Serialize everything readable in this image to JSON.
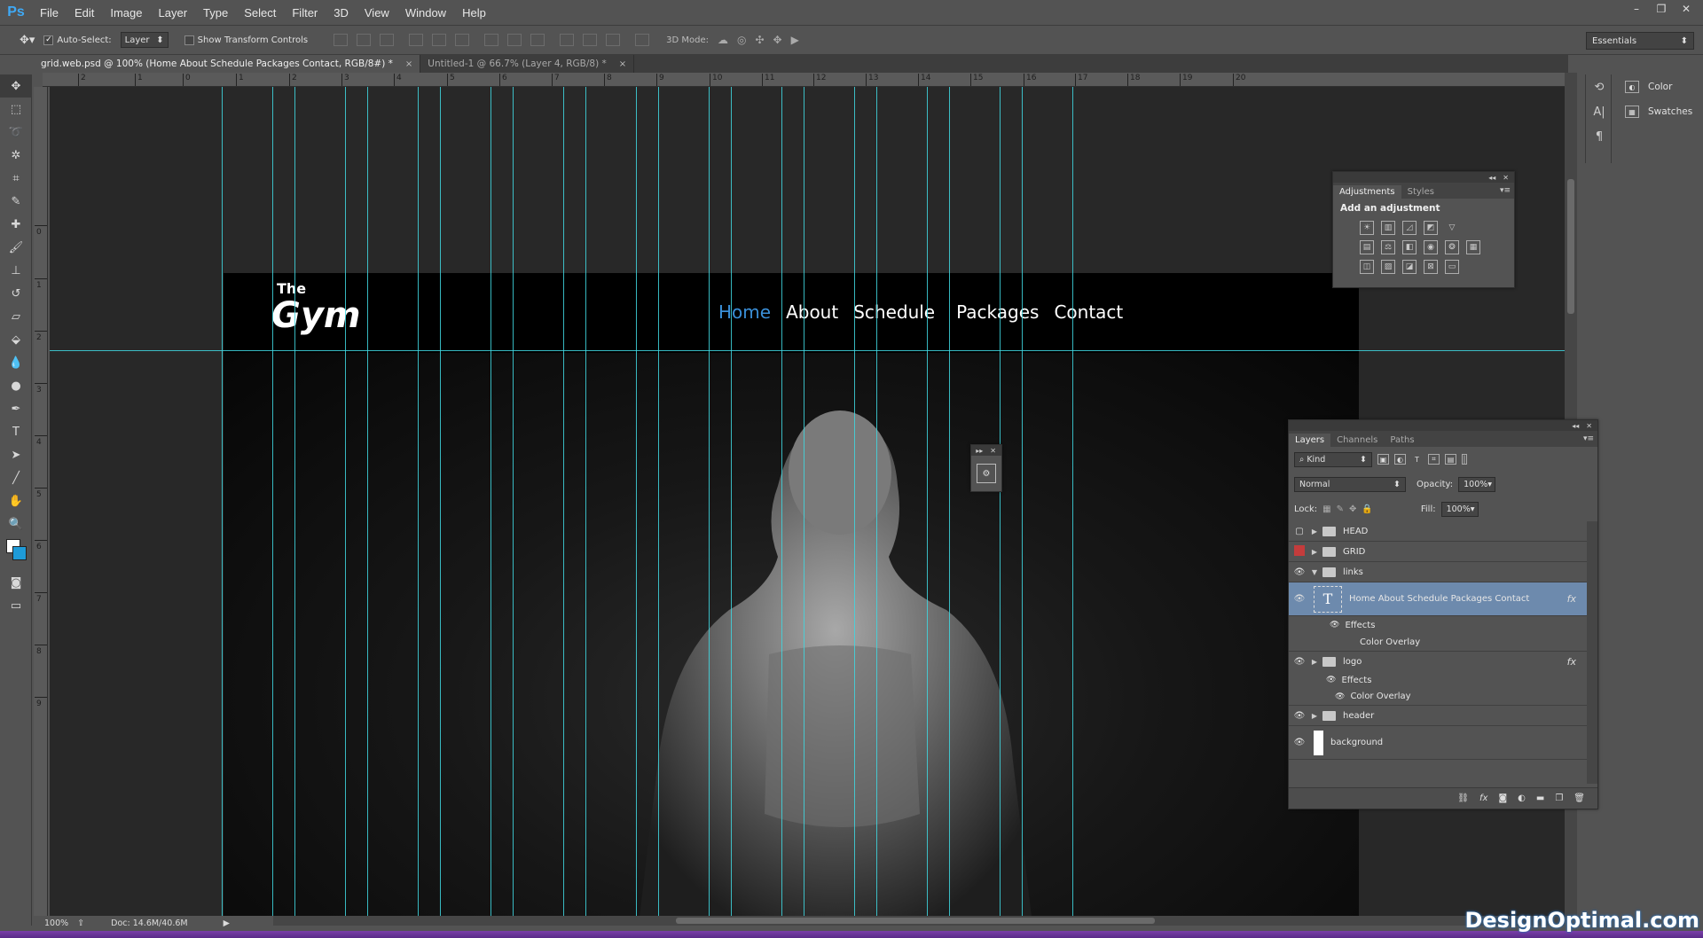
{
  "app": {
    "logo": "Ps"
  },
  "menu": [
    "File",
    "Edit",
    "Image",
    "Layer",
    "Type",
    "Select",
    "Filter",
    "3D",
    "View",
    "Window",
    "Help"
  ],
  "window_controls": [
    "–",
    "❐",
    "✕"
  ],
  "options": {
    "auto_select_label": "Auto-Select:",
    "auto_select_value": "Layer",
    "show_transform_label": "Show Transform Controls",
    "mode_3d_label": "3D Mode:",
    "workspace": "Essentials"
  },
  "tabs": [
    {
      "label": "grid.web.psd @ 100% (Home About Schedule Packages Contact, RGB/8#) *",
      "close": "×"
    },
    {
      "label": "Untitled-1 @ 66.7% (Layer 4, RGB/8) *",
      "close": "×"
    }
  ],
  "ruler_top": [
    "2",
    "1",
    "0",
    "1",
    "2",
    "3",
    "4",
    "5",
    "6",
    "7",
    "8",
    "9",
    "10",
    "11",
    "12",
    "13",
    "14",
    "15",
    "16",
    "17",
    "18",
    "19",
    "20"
  ],
  "ruler_left": [
    "2",
    "0",
    "1",
    "2",
    "3",
    "4",
    "5",
    "6",
    "7",
    "8",
    "9"
  ],
  "site": {
    "logo_the": "The",
    "logo_gym": "Gym",
    "nav": [
      "Home",
      "About",
      "Schedule",
      "Packages",
      "Contact"
    ],
    "active_color": "#3a8fd8"
  },
  "status": {
    "zoom": "100%",
    "doc": "Doc: 14.6M/40.6M"
  },
  "dock": {
    "color": "Color",
    "swatches": "Swatches"
  },
  "adjustments": {
    "tabs": [
      "Adjustments",
      "Styles"
    ],
    "title": "Add an adjustment"
  },
  "layers_panel": {
    "tabs": [
      "Layers",
      "Channels",
      "Paths"
    ],
    "filter_kind": "Kind",
    "blend_mode": "Normal",
    "opacity_label": "Opacity:",
    "opacity_value": "100%",
    "lock_label": "Lock:",
    "fill_label": "Fill:",
    "fill_value": "100%",
    "layers": [
      {
        "name": "HEAD"
      },
      {
        "name": "GRID"
      },
      {
        "name": "links"
      },
      {
        "name": "Home About Schedule Packages Contact",
        "fx": "fx"
      },
      {
        "name": "Effects"
      },
      {
        "name": "Color Overlay"
      },
      {
        "name": "logo",
        "fx": "fx"
      },
      {
        "name": "Effects"
      },
      {
        "name": "Color Overlay"
      },
      {
        "name": "header"
      },
      {
        "name": "background"
      }
    ]
  },
  "watermark": "DesignOptimal.com",
  "accent_guide_color": "#3fd7e0"
}
